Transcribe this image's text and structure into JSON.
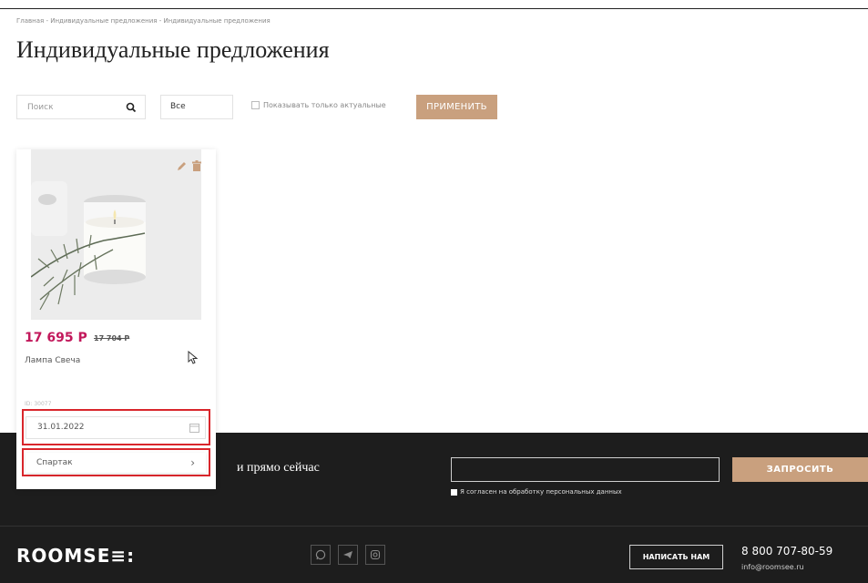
{
  "breadcrumb": "Главная - Индивидуальные предложения - Индивидуальные предложения",
  "page_title": "Индивидуальные предложения",
  "filters": {
    "search_placeholder": "Поиск",
    "search_value": "",
    "select_value": "Все",
    "checkbox_label": "Показывать только актуальные",
    "apply_label": "ПРИМЕНИТЬ"
  },
  "product": {
    "price": "17 695 Р",
    "old_price": "17 704 Р",
    "name": "Лампа Свеча",
    "id_label": "ID: 30077",
    "date": "31.01.2022",
    "store": "Спартак"
  },
  "footer": {
    "heading": "и прямо сейчас",
    "request_label": "ЗАПРОСИТЬ",
    "consent": "Я согласен на обработку персональных данных",
    "logo": "ROOMSE≡:",
    "write_label": "НАПИСАТЬ НАМ",
    "phone": "8 800 707-80-59",
    "email": "info@roomsee.ru"
  },
  "colors": {
    "accent": "#c9a07e",
    "price": "#c2185b",
    "highlight": "#d9262c",
    "footer_bg": "#1d1d1d"
  },
  "icons": [
    "search-icon",
    "edit-icon",
    "delete-icon",
    "calendar-icon",
    "chevron-right-icon",
    "whatsapp-icon",
    "telegram-icon",
    "instagram-icon"
  ]
}
